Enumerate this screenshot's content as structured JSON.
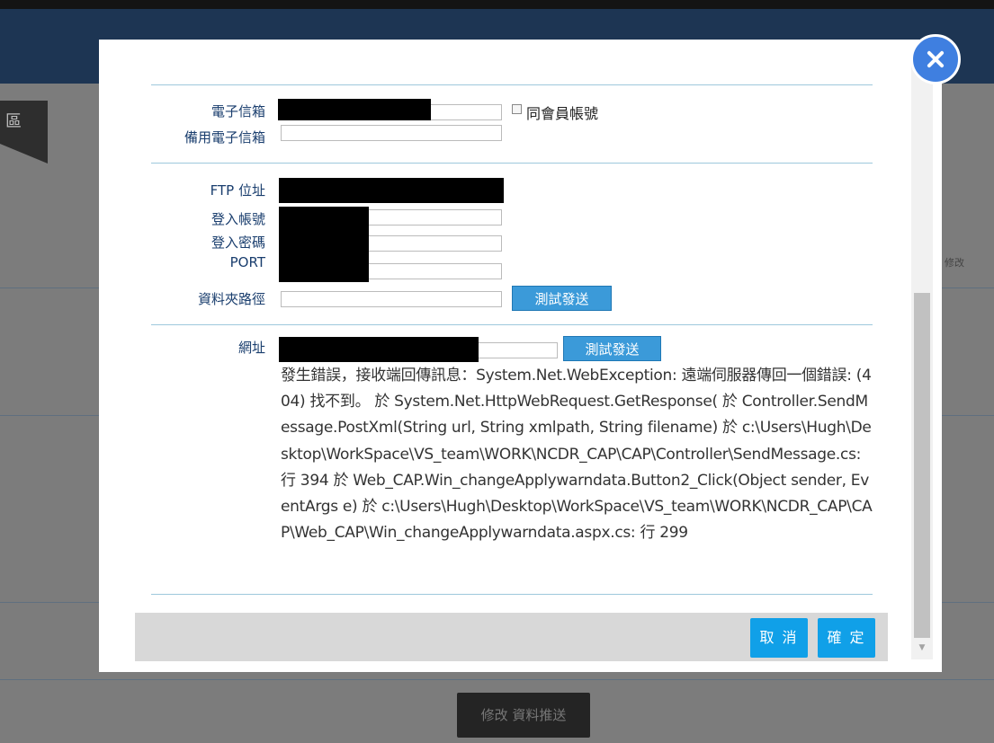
{
  "background": {
    "side_tag": "區",
    "side_text": "修改",
    "bottom_button": "修改 資料推送"
  },
  "form": {
    "email_label": "電子信箱",
    "same_as_member_label": "同會員帳號",
    "backup_email_label": "備用電子信箱",
    "ftp_address_label": "FTP 位址",
    "login_account_label": "登入帳號",
    "login_password_label": "登入密碼",
    "port_label": "PORT",
    "folder_path_label": "資料夾路徑",
    "ftp_test_button": "測試發送",
    "url_label": "網址",
    "url_test_button": "測試發送",
    "error_message": "發生錯誤，接收端回傳訊息：System.Net.WebException: 遠端伺服器傳回一個錯誤: (404) 找不到。 於 System.Net.HttpWebRequest.GetResponse( 於 Controller.SendMessage.PostXml(String url, String xmlpath, String filename) 於 c:\\Users\\Hugh\\Desktop\\WorkSpace\\VS_team\\WORK\\NCDR_CAP\\CAP\\Controller\\SendMessage.cs: 行 394 於 Web_CAP.Win_changeApplywarndata.Button2_Click(Object sender, EventArgs e) 於 c:\\Users\\Hugh\\Desktop\\WorkSpace\\VS_team\\WORK\\NCDR_CAP\\CAP\\Web_CAP\\Win_changeApplywarndata.aspx.cs: 行 299"
  },
  "footer": {
    "cancel_label": "取 消",
    "confirm_label": "確 定"
  },
  "colors": {
    "label_text": "#1a3e6e",
    "button_blue": "#10a0e8",
    "close_blue": "#3f7fe0",
    "separator": "#9ec8dc"
  },
  "icons": {
    "close": "close-icon"
  }
}
